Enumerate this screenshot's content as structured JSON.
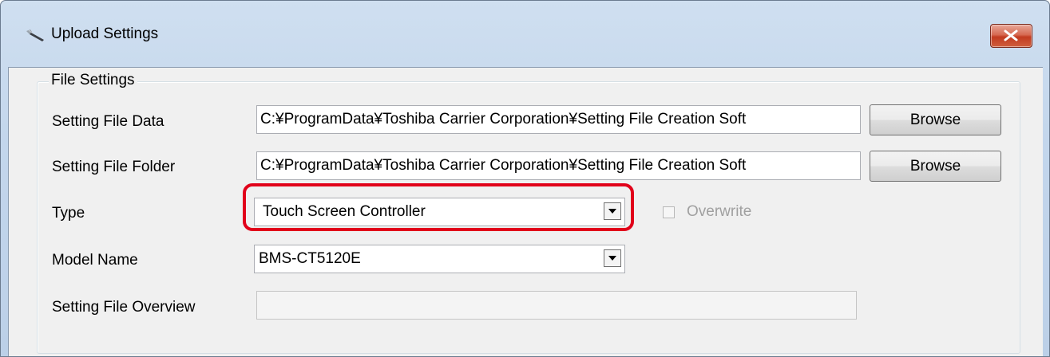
{
  "window": {
    "title": "Upload Settings",
    "icon": "wrench-icon",
    "close_icon": "close-icon"
  },
  "file_settings": {
    "legend": "File Settings",
    "setting_file_data": {
      "label": "Setting File Data",
      "value": "C:¥ProgramData¥Toshiba Carrier Corporation¥Setting File Creation Soft",
      "browse_label": "Browse"
    },
    "setting_file_folder": {
      "label": "Setting File Folder",
      "value": "C:¥ProgramData¥Toshiba Carrier Corporation¥Setting File Creation Soft",
      "browse_label": "Browse"
    },
    "type": {
      "label": "Type",
      "selected": "Touch Screen Controller",
      "highlight_color": "#e1001a"
    },
    "overwrite": {
      "label": "Overwrite",
      "checked": false,
      "enabled": false
    },
    "model_name": {
      "label": "Model Name",
      "selected": "BMS-CT5120E"
    },
    "setting_file_overview": {
      "label": "Setting File Overview",
      "value": ""
    }
  },
  "colors": {
    "title_bar": "#c3d6ec",
    "close_button": "#c94a2e",
    "dialog_bg": "#f0f0f0"
  }
}
